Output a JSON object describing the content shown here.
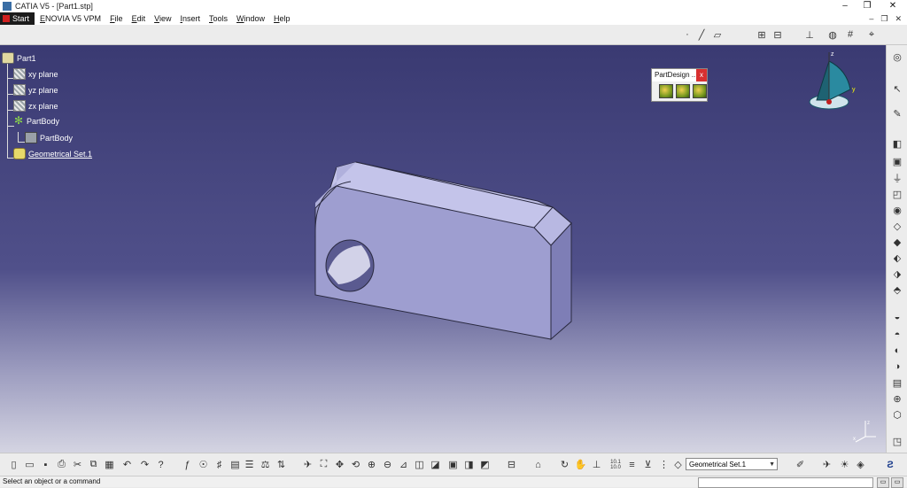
{
  "window": {
    "title": "CATIA V5 - [Part1.stp]",
    "minimize_icon": "minimize-icon",
    "maximize_icon": "restore-icon",
    "close_icon": "close-icon",
    "min_label": "–",
    "max_label": "❐",
    "close_label": "✕"
  },
  "menubar": {
    "start_label": "Start",
    "items": [
      "ENOVIA V5 VPM",
      "File",
      "Edit",
      "View",
      "Insert",
      "Tools",
      "Window",
      "Help"
    ],
    "doc_controls": [
      "–",
      "❐",
      "✕"
    ]
  },
  "tree": {
    "root": "Part1",
    "nodes": [
      {
        "label": "xy plane",
        "icon": "plane-icon"
      },
      {
        "label": "yz plane",
        "icon": "plane-icon"
      },
      {
        "label": "zx plane",
        "icon": "plane-icon"
      },
      {
        "label": "PartBody",
        "icon": "gear-icon"
      },
      {
        "label": "PartBody",
        "icon": "body-icon"
      },
      {
        "label": "Geometrical Set.1",
        "icon": "geometrical-set-icon"
      }
    ]
  },
  "partdesign_toolbar": {
    "title": "PartDesign ...",
    "close_label": "x"
  },
  "compass": {
    "z_label": "z",
    "y_label": "y"
  },
  "mini_axes": {
    "z_label": "z",
    "x_label": "x"
  },
  "bottom_toolbar": {
    "current_set": "Geometrical Set.1",
    "scale_label": "10.1\n10.0"
  },
  "status": {
    "message": "Select an object or a command"
  },
  "colors": {
    "background_top": "#3a3a72",
    "background_bottom": "#d4d4e2",
    "part_face": "#a8a8d8",
    "part_side": "#8080b8"
  }
}
